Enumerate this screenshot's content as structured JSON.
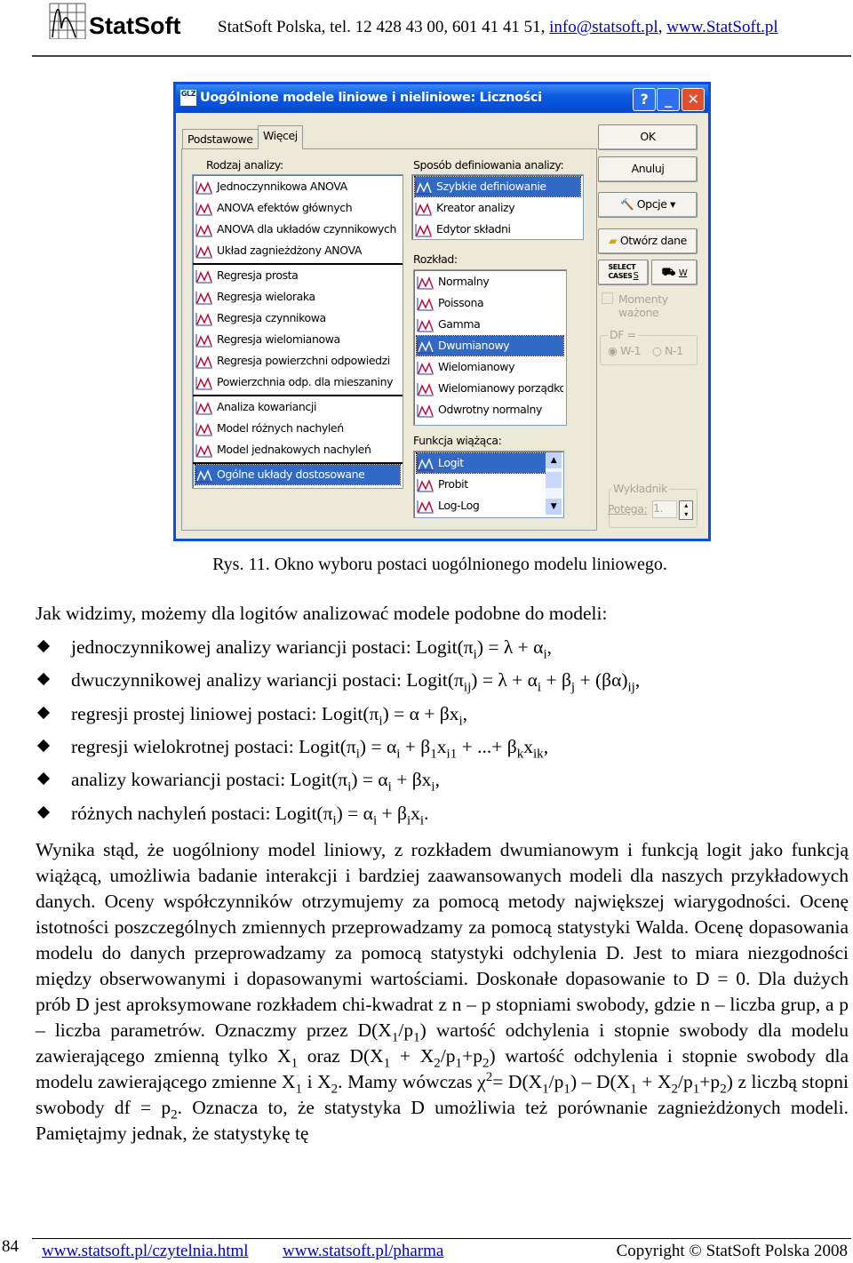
{
  "header": {
    "logo_text": "StatSoft",
    "contact": "StatSoft Polska, tel. 12 428 43 00, 601 41 41 51, ",
    "email": "info@statsoft.pl",
    "sep": ", ",
    "website": "www.StatSoft.pl"
  },
  "dialog": {
    "title": "Ogólnione",
    "title_full": "Uogólnione modele liniowe i nieliniowe: Liczności",
    "icon_text": "GLZ",
    "tabs": [
      "Podstawowe",
      "Więcej"
    ],
    "analysis_label": "Rodzaj analizy:",
    "analysis_items": [
      "Jednoczynnikowa ANOVA",
      "ANOVA efektów głównych",
      "ANOVA dla układów czynnikowych",
      "Układ zagnieżdżony ANOVA",
      "Regresja prosta",
      "Regresja wieloraka",
      "Regresja czynnikowa",
      "Regresja wielomianowa",
      "Regresja powierzchni odpowiedzi",
      "Powierzchnia odp. dla mieszaniny",
      "Analiza kowariancji",
      "Model różnych nachyleń",
      "Model jednakowych nachyleń",
      "Ogólne układy dostosowane"
    ],
    "analysis_selected": "Ogólne układy dostosowane",
    "method_label": "Sposób definiowania analizy:",
    "method_items": [
      "Szybkie definiowanie",
      "Kreator analizy",
      "Edytor składni"
    ],
    "method_selected": "Szybkie definiowanie",
    "distribution_label": "Rozkład:",
    "distribution_items": [
      "Normalny",
      "Poissona",
      "Gamma",
      "Dwumianowy",
      "Wielomianowy",
      "Wielomianowy porządkowy",
      "Odwrotny normalny"
    ],
    "distribution_selected": "Dwumianowy",
    "link_label": "Funkcja wiążąca:",
    "link_items": [
      "Logit",
      "Probit",
      "Log-Log"
    ],
    "link_selected": "Logit",
    "buttons": {
      "ok": "OK",
      "cancel": "Anuluj",
      "options": "Opcje",
      "open_data": "Otwórz dane",
      "select_cases": "SELECT CASES",
      "s": "S",
      "w": "W"
    },
    "weighted_moments": "Momenty ważone",
    "df_label": "DF =",
    "df_options": [
      "W-1",
      "N-1"
    ],
    "df_selected": "W-1",
    "exponent_group": "Wykładnik",
    "power_label": "Potęga:",
    "power_value": "1."
  },
  "caption": "Rys. 11. Okno wyboru postaci uogólnionego modelu liniowego.",
  "intro": "Jak widzimy, możemy dla logitów analizować modele podobne do modeli:",
  "bullets": [
    [
      [
        "jednoczynnikowej analizy wariancji postaci: Logit(π",
        ""
      ],
      [
        "i",
        "sub"
      ],
      [
        ") = λ + α",
        ""
      ],
      [
        "i",
        "sub"
      ],
      [
        ",",
        ""
      ]
    ],
    [
      [
        "dwuczynnikowej analizy wariancji postaci: Logit(π",
        ""
      ],
      [
        "ij",
        "sub"
      ],
      [
        ") = λ + α",
        ""
      ],
      [
        "i",
        "sub"
      ],
      [
        " + β",
        ""
      ],
      [
        "j",
        "sub"
      ],
      [
        " + (βα)",
        ""
      ],
      [
        "ij",
        "sub"
      ],
      [
        ",",
        ""
      ]
    ],
    [
      [
        "regresji prostej liniowej postaci: Logit(π",
        ""
      ],
      [
        "i",
        "sub"
      ],
      [
        ") = α + βx",
        ""
      ],
      [
        "i",
        "sub"
      ],
      [
        ",",
        ""
      ]
    ],
    [
      [
        "regresji wielokrotnej postaci: Logit(π",
        ""
      ],
      [
        "i",
        "sub"
      ],
      [
        ") = α",
        ""
      ],
      [
        "i",
        "sub"
      ],
      [
        " + β",
        ""
      ],
      [
        "1",
        "sub"
      ],
      [
        "x",
        ""
      ],
      [
        "i1",
        "sub"
      ],
      [
        " + ...+ β",
        ""
      ],
      [
        "k",
        "sub"
      ],
      [
        "x",
        ""
      ],
      [
        "ik",
        "sub"
      ],
      [
        ",",
        ""
      ]
    ],
    [
      [
        "analizy kowariancji postaci: Logit(π",
        ""
      ],
      [
        "i",
        "sub"
      ],
      [
        ") = α",
        ""
      ],
      [
        "i",
        "sub"
      ],
      [
        " + βx",
        ""
      ],
      [
        "i",
        "sub"
      ],
      [
        ",",
        ""
      ]
    ],
    [
      [
        "różnych nachyleń postaci: Logit(π",
        ""
      ],
      [
        "i",
        "sub"
      ],
      [
        ") = α",
        ""
      ],
      [
        "i",
        "sub"
      ],
      [
        " + β",
        ""
      ],
      [
        "i",
        "sub"
      ],
      [
        "x",
        ""
      ],
      [
        "i",
        "sub"
      ],
      [
        ".",
        ""
      ]
    ]
  ],
  "paragraph": [
    [
      "Wynika stąd, że uogólniony model liniowy, z rozkładem dwumianowym i funkcją logit jako funkcją wiążącą, umożliwia badanie interakcji i bardziej zaawansowanych modeli dla naszych przykładowych danych. Oceny współczynników otrzymujemy za pomocą metody największej wiarygodności. Ocenę istotności poszczególnych zmiennych przeprowadzamy za pomocą statystyki Walda. Ocenę dopasowania modelu do danych przeprowadzamy za pomocą statystyki odchylenia D. Jest to miara niezgodności między obserwowanymi i dopasowanymi wartościami. Doskonałe dopasowanie to D = 0. Dla dużych prób D jest aproksymowane rozkładem chi-kwadrat z n – p stopniami swobody, gdzie n – liczba grup, a p – liczba parametrów. Oznaczmy przez D(X",
      ""
    ],
    [
      "1",
      "sub"
    ],
    [
      "/p",
      ""
    ],
    [
      "1",
      "sub"
    ],
    [
      ") wartość odchylenia i stopnie swobody dla modelu zawierającego zmienną tylko X",
      ""
    ],
    [
      "1",
      "sub"
    ],
    [
      " oraz D(X",
      ""
    ],
    [
      "1",
      "sub"
    ],
    [
      " + X",
      ""
    ],
    [
      "2",
      "sub"
    ],
    [
      "/p",
      ""
    ],
    [
      "1",
      "sub"
    ],
    [
      "+p",
      ""
    ],
    [
      "2",
      "sub"
    ],
    [
      ") wartość odchylenia i stopnie swobody dla modelu zawierającego zmienne X",
      ""
    ],
    [
      "1",
      "sub"
    ],
    [
      " i X",
      ""
    ],
    [
      "2",
      "sub"
    ],
    [
      ". Mamy wówczas χ",
      ""
    ],
    [
      "2",
      "sup"
    ],
    [
      "= D(X",
      ""
    ],
    [
      "1",
      "sub"
    ],
    [
      "/p",
      ""
    ],
    [
      "1",
      "sub"
    ],
    [
      ") – D(X",
      ""
    ],
    [
      "1",
      "sub"
    ],
    [
      " + X",
      ""
    ],
    [
      "2",
      "sub"
    ],
    [
      "/p",
      ""
    ],
    [
      "1",
      "sub"
    ],
    [
      "+p",
      ""
    ],
    [
      "2",
      "sub"
    ],
    [
      ") z liczbą stopni swobody df = p",
      ""
    ],
    [
      "2",
      "sub"
    ],
    [
      ". Oznacza to, że statystyka D umożliwia też porównanie zagnieżdżonych modeli. Pamiętajmy jednak, że statystykę tę",
      ""
    ]
  ],
  "footer": {
    "page_number": "84",
    "link1": "www.statsoft.pl/czytelnia.html",
    "link2": "www.statsoft.pl/pharma",
    "copyright": "Copyright © StatSoft Polska 2008"
  },
  "colors": {
    "titlebar": "#0a5ae0",
    "selection": "#316ac5",
    "dialog_bg": "#ece9d8",
    "link": "#0000cc",
    "close_button": "#e0502e"
  }
}
